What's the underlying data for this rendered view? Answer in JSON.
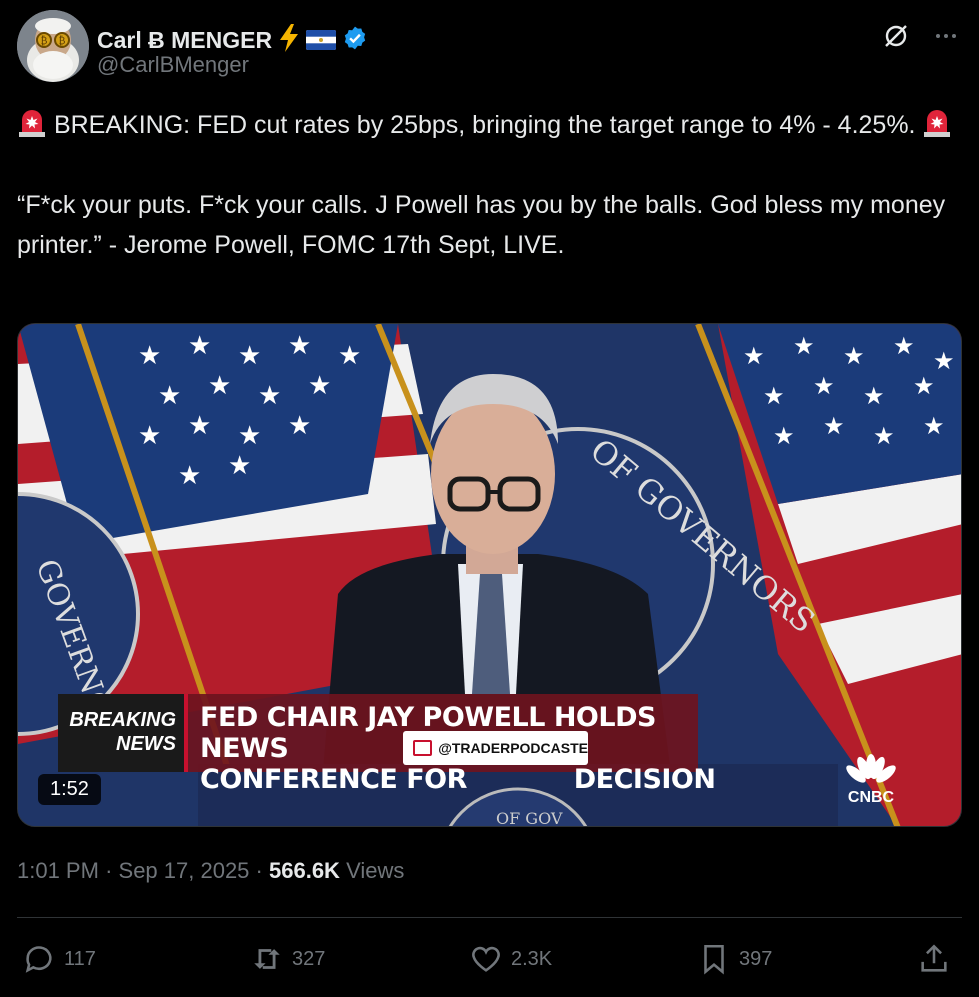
{
  "author": {
    "display_name": "Carl Ƀ MENGER",
    "handle": "@CarlBMenger",
    "emoji_icons": [
      "lightning-icon",
      "el-salvador-flag-icon",
      "verified-badge-icon"
    ]
  },
  "tweet": {
    "line1": "BREAKING: FED cut rates by 25bps, bringing the target range to 4% - 4.25%.",
    "quote": "“F*ck your puts. F*ck your calls. J Powell has you by the balls. God bless my money printer.” - Jerome Powell, FOMC 17th Sept, LIVE."
  },
  "media": {
    "duration": "1:52",
    "chyron_left_1": "BREAKING",
    "chyron_left_2": "NEWS",
    "chyron_line1": "FED CHAIR JAY POWELL HOLDS NEWS",
    "chyron_line2": "CONFERENCE FOR            DECISION",
    "watermark": "@TRADERPODCASTE",
    "network": "CNBC",
    "seal_text": "OF GOVERNORS",
    "seal_text_left": "GOVERNO",
    "podium_text": "OF GOV"
  },
  "meta": {
    "time": "1:01 PM",
    "separator": "·",
    "date": "Sep 17, 2025",
    "views_count": "566.6K",
    "views_label": "Views"
  },
  "actions": {
    "replies": "117",
    "reposts": "327",
    "likes": "2.3K",
    "bookmarks": "397"
  },
  "colors": {
    "background": "#000000",
    "text": "#e7e9ea",
    "muted": "#71767b",
    "verified": "#1d9bf0",
    "divider": "#2f3336"
  }
}
